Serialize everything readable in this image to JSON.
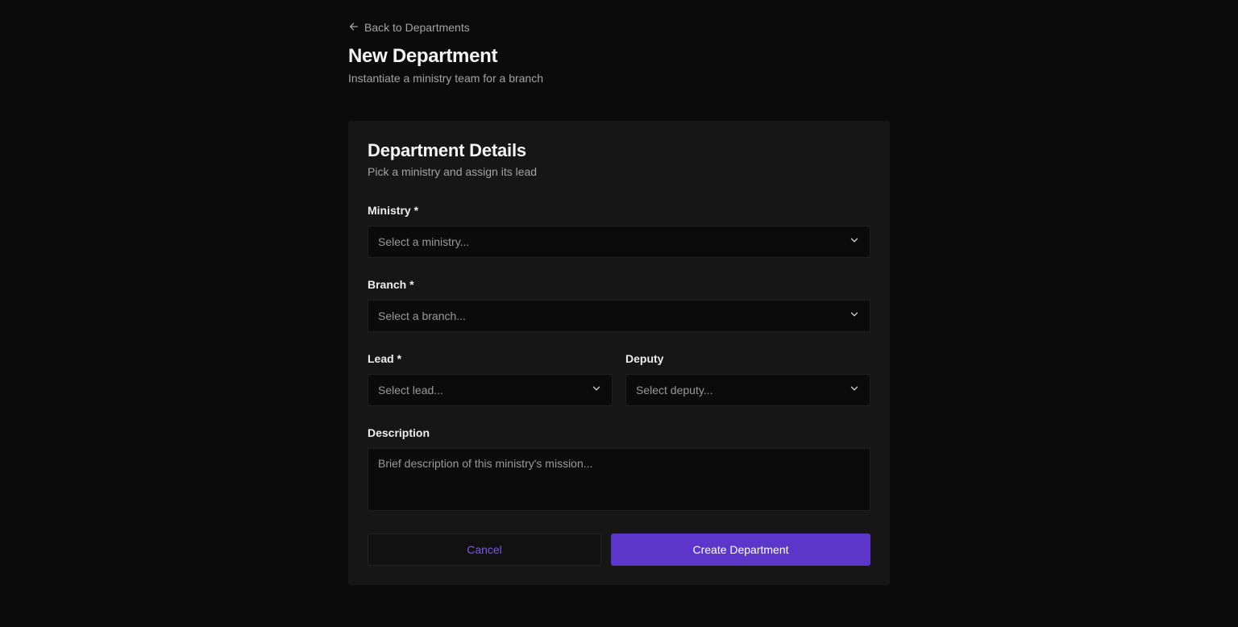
{
  "header": {
    "back_label": "Back to Departments",
    "title": "New Department",
    "subtitle": "Instantiate a ministry team for a branch"
  },
  "card": {
    "title": "Department Details",
    "subtitle": "Pick a ministry and assign its lead"
  },
  "form": {
    "ministry": {
      "label": "Ministry *",
      "placeholder": "Select a ministry..."
    },
    "branch": {
      "label": "Branch *",
      "placeholder": "Select a branch..."
    },
    "lead": {
      "label": "Lead *",
      "placeholder": "Select lead..."
    },
    "deputy": {
      "label": "Deputy",
      "placeholder": "Select deputy..."
    },
    "description": {
      "label": "Description",
      "placeholder": "Brief description of this ministry's mission..."
    }
  },
  "actions": {
    "cancel_label": "Cancel",
    "create_label": "Create Department"
  },
  "colors": {
    "background": "#0b0b0b",
    "card": "#161616",
    "accent": "#5b36c9",
    "accent_text": "#7c5cdc"
  },
  "icons": {
    "back": "arrow-left-icon",
    "dropdown": "chevron-down-icon"
  }
}
